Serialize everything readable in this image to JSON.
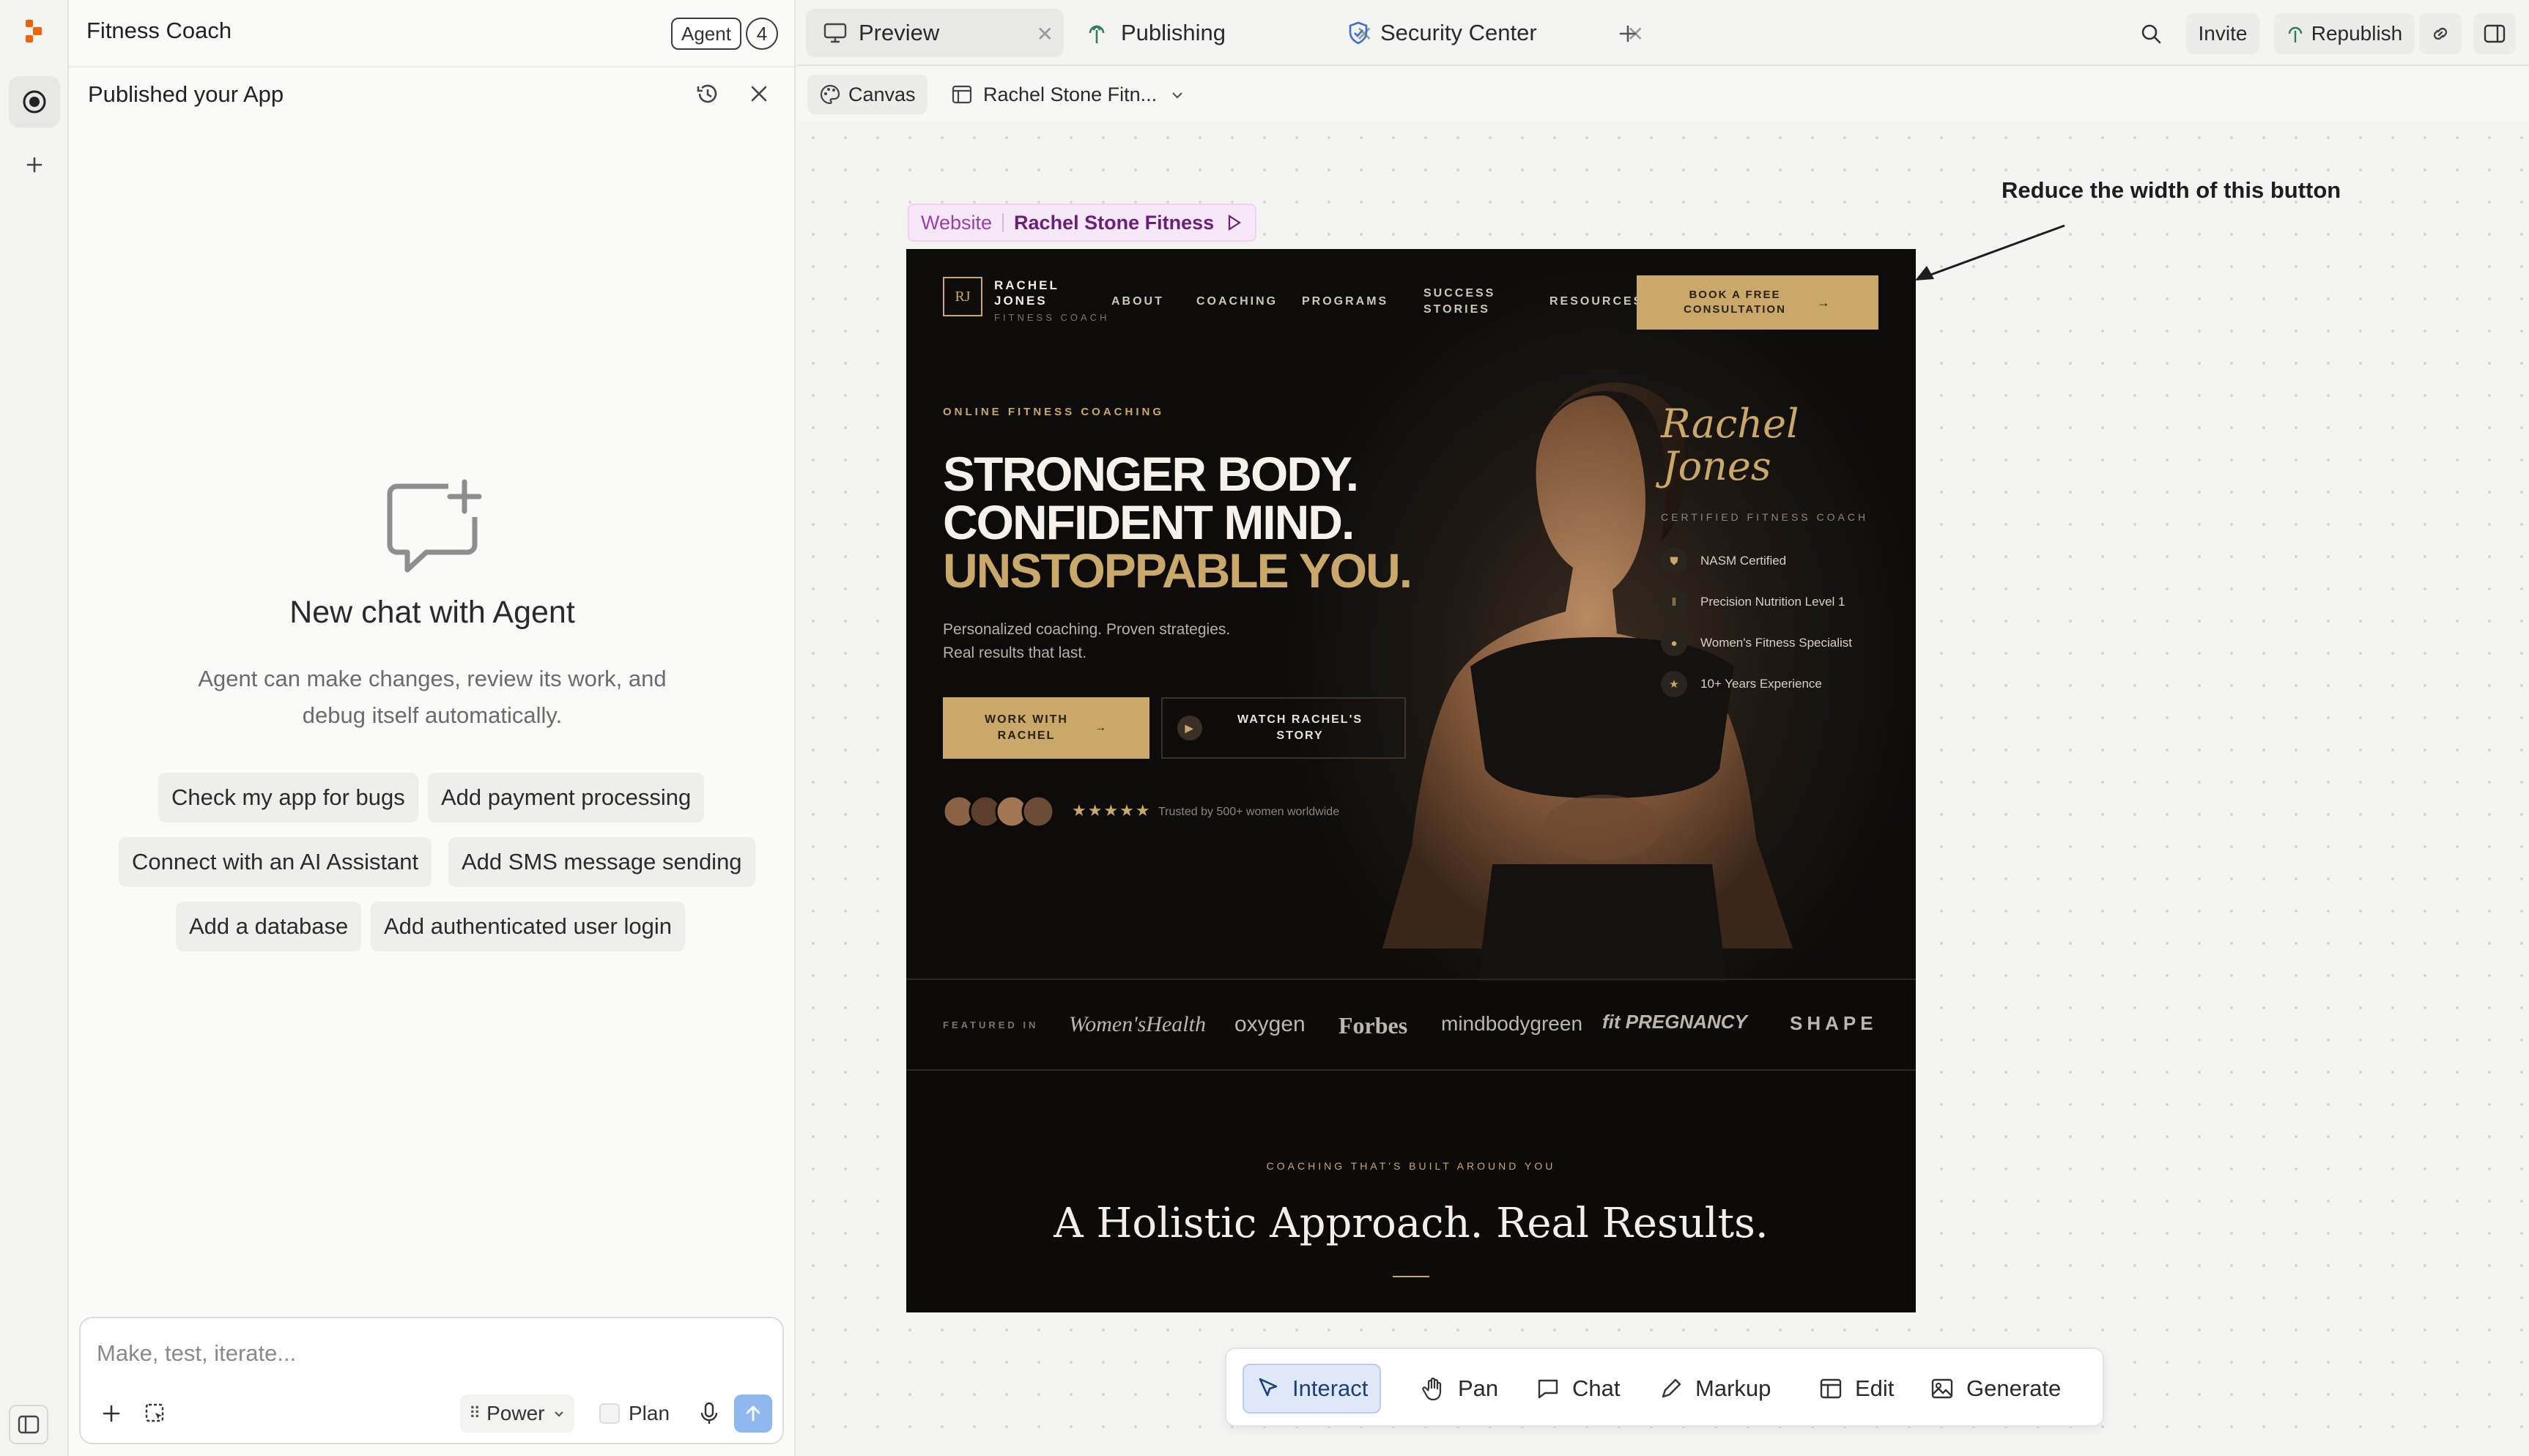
{
  "panel": {
    "title": "Fitness Coach",
    "agent_label": "Agent",
    "agent_count": "4",
    "published_title": "Published your App",
    "new_chat_title": "New chat with Agent",
    "new_chat_desc_1": "Agent can make changes, review its work, and",
    "new_chat_desc_2": "debug itself automatically.",
    "suggestions": [
      "Check my app for bugs",
      "Add payment processing",
      "Connect with an AI Assistant",
      "Add SMS message sending",
      "Add a database",
      "Add authenticated user login"
    ],
    "composer_placeholder": "Make, test, iterate...",
    "mode_label": "Power",
    "plan_label": "Plan"
  },
  "tabs": [
    {
      "label": "Preview",
      "icon": "monitor-icon"
    },
    {
      "label": "Publishing",
      "icon": "publish-icon"
    },
    {
      "label": "Security Center",
      "icon": "shield-icon"
    }
  ],
  "header": {
    "invite_label": "Invite",
    "republish_label": "Republish"
  },
  "subbar": {
    "canvas_label": "Canvas",
    "page_label": "Rachel Stone Fitn..."
  },
  "canvas": {
    "frame_type": "Website",
    "frame_name": "Rachel Stone Fitness",
    "annotation": "Reduce the width of this button"
  },
  "site": {
    "brand_line1": "RACHEL",
    "brand_line2": "JONES",
    "brand_sub": "FITNESS COACH",
    "brand_mark": "RJ",
    "nav": [
      "ABOUT",
      "COACHING",
      "PROGRAMS",
      "SUCCESS",
      "STORIES",
      "RESOURCES"
    ],
    "book_line1": "BOOK A FREE",
    "book_line2": "CONSULTATION",
    "eyebrow": "ONLINE FITNESS COACHING",
    "headline1": "STRONGER BODY.",
    "headline2": "CONFIDENT MIND.",
    "headline3": "UNSTOPPABLE YOU.",
    "lede1": "Personalized coaching. Proven strategies.",
    "lede2": "Real results that last.",
    "cta1_line1": "WORK WITH",
    "cta1_line2": "RACHEL",
    "cta2_line1": "WATCH RACHEL'S",
    "cta2_line2": "STORY",
    "trust": "Trusted by 500+ women worldwide",
    "stars": "★★★★★",
    "signature1": "Rachel",
    "signature2": "Jones",
    "cert_title": "CERTIFIED FITNESS COACH",
    "certs": [
      "NASM Certified",
      "Precision Nutrition Level 1",
      "Women's Fitness Specialist",
      "10+ Years Experience"
    ],
    "featured_label": "FEATURED IN",
    "logos": [
      "Women'sHealth",
      "oxygen",
      "Forbes",
      "mindbodygreen",
      "fit PREGNANCY",
      "SHAPE"
    ],
    "section_eyebrow": "COACHING THAT'S BUILT AROUND YOU",
    "section_title": "A Holistic Approach. Real Results."
  },
  "toolbar": [
    "Interact",
    "Pan",
    "Chat",
    "Markup",
    "Edit",
    "Generate"
  ],
  "colors": {
    "gold": "#c9a86a",
    "accent_blue": "#8fb7f0",
    "site_bg": "#0c0b0a"
  }
}
